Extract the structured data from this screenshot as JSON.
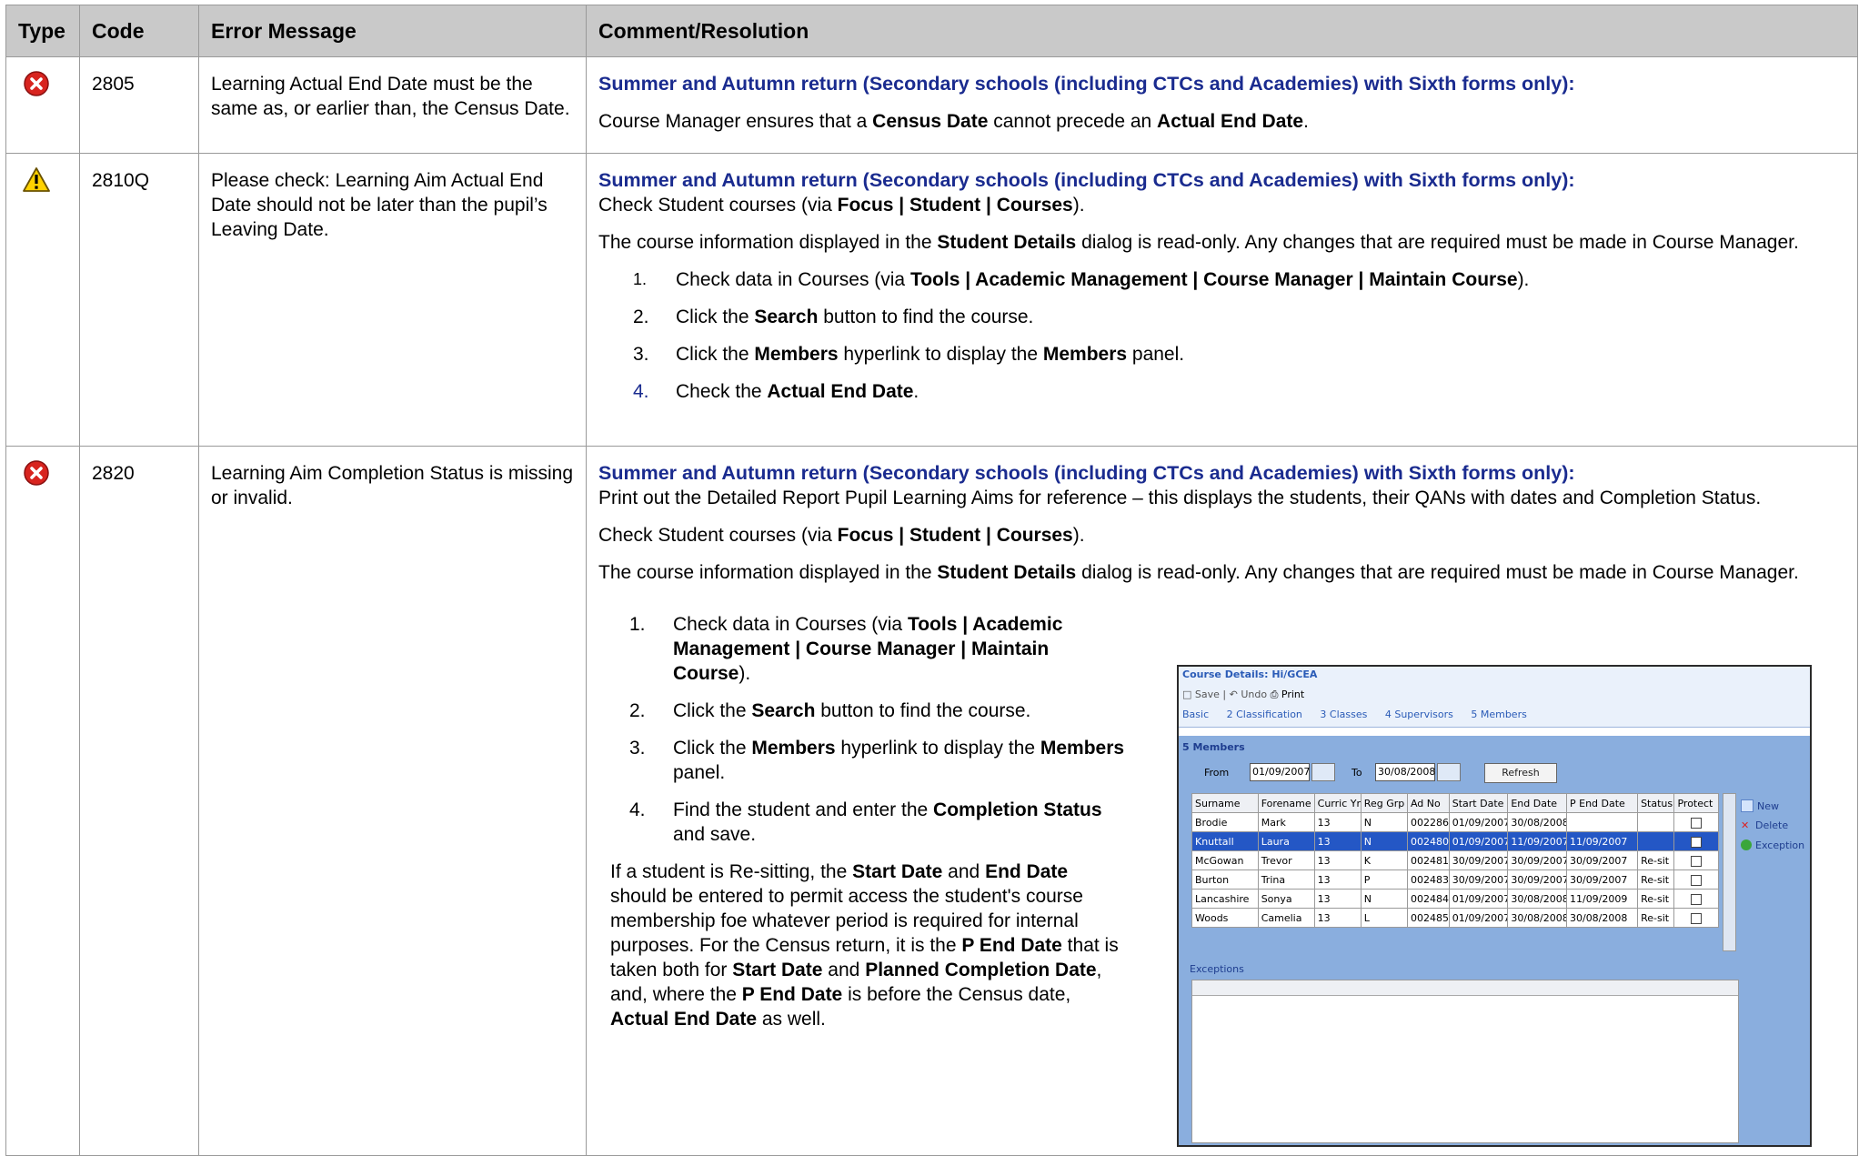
{
  "headers": {
    "type": "Type",
    "code": "Code",
    "error": "Error Message",
    "comment": "Comment/Resolution"
  },
  "rows": [
    {
      "icon": "error-icon",
      "code": "2805",
      "error": "Learning Actual End Date must be the same as, or earlier than, the Census Date.",
      "heading": "Summer and Autumn return (Secondary schools (including CTCs and Academies) with Sixth forms only):",
      "p1_a": "Course Manager ensures that a ",
      "p1_b": "Census Date",
      "p1_c": " cannot precede an ",
      "p1_d": "Actual End Date",
      "p1_e": "."
    },
    {
      "icon": "warning-icon",
      "code": "2810Q",
      "error": "Please check: Learning Aim Actual End Date should not be later than the pupil’s Leaving Date.",
      "heading": "Summer and Autumn return (Secondary schools (including CTCs and Academies) with Sixth forms only):",
      "check_a": "Check Student courses (via ",
      "check_b": "Focus | Student | Courses",
      "check_c": ").",
      "info_a": "The course information displayed in the ",
      "info_b": "Student Details",
      "info_c": " dialog is read-only. Any changes that are required must be made in Course Manager.",
      "steps": [
        {
          "num": "1.",
          "a": "Check data in Courses (via ",
          "b": "Tools | Academic Management | Course Manager | Maintain Course",
          "c": ")."
        },
        {
          "num": "2.",
          "a": "Click the ",
          "b": "Search",
          "c": " button to find the course."
        },
        {
          "num": "3.",
          "a": "Click the ",
          "b": "Members",
          "c": " hyperlink to display the ",
          "d": "Members",
          "e": " panel."
        },
        {
          "num": "4.",
          "a": "Check the ",
          "b": "Actual End Date",
          "c": "."
        }
      ]
    },
    {
      "icon": "error-icon",
      "code": "2820",
      "error": "Learning Aim Completion Status is missing or invalid.",
      "heading": "Summer and Autumn return (Secondary schools (including CTCs and Academies) with Sixth forms only):",
      "print": "Print out the Detailed Report Pupil Learning Aims for reference – this displays the students, their QANs with dates and Completion Status.",
      "check_a": "Check Student courses (via ",
      "check_b": "Focus | Student | Courses",
      "check_c": ").",
      "info_a": "The course information displayed in the ",
      "info_b": "Student Details",
      "info_c": " dialog is read-only. Any changes that are required must be made in Course Manager.",
      "steps": [
        {
          "num": "1.",
          "a": "Check data in Courses (via ",
          "b": "Tools | Academic Management | Course Manager | Maintain Course",
          "c": ")."
        },
        {
          "num": "2.",
          "a": "Click the ",
          "b": "Search",
          "c": " button to find the course."
        },
        {
          "num": "3.",
          "a": "Click the ",
          "b": "Members",
          "c": " hyperlink to display the ",
          "d": "Members",
          "e": " panel."
        },
        {
          "num": "4.",
          "a": "Find the student and enter the ",
          "b": "Completion Status",
          "c": " and save."
        }
      ],
      "resit": [
        {
          "t": "If a student is Re-sitting, the ",
          "b": false
        },
        {
          "t": "Start Date",
          "b": true
        },
        {
          "t": " and ",
          "b": false
        },
        {
          "t": "End Date",
          "b": true
        },
        {
          "t": " should be entered to permit access the student's course membership foe whatever period is required for internal purposes.  For the Census return, it is the ",
          "b": false
        },
        {
          "t": "P End Date",
          "b": true
        },
        {
          "t": " that is taken both for ",
          "b": false
        },
        {
          "t": "Start Date",
          "b": true
        },
        {
          "t": " and ",
          "b": false
        },
        {
          "t": "Planned Completion Date",
          "b": true
        },
        {
          "t": ", and, where the ",
          "b": false
        },
        {
          "t": "P End Date",
          "b": true
        },
        {
          "t": " is before the Census date, ",
          "b": false
        },
        {
          "t": "Actual End Date",
          "b": true
        },
        {
          "t": " as well.",
          "b": false
        }
      ]
    }
  ],
  "screenshot": {
    "title": "Course Details: Hi/GCEA",
    "toolbar": [
      "Save",
      "Undo",
      "Print"
    ],
    "tabs": [
      "Basic",
      "2 Classification",
      "3 Classes",
      "4 Supervisors",
      "5 Members"
    ],
    "panel_title": "5 Members",
    "from_label": "From",
    "from_value": "01/09/2007",
    "to_label": "To",
    "to_value": "30/08/2008",
    "refresh": "Refresh",
    "columns": [
      "Surname",
      "Forename",
      "Curric Yr",
      "Reg Grp",
      "Ad No",
      "Start Date",
      "End Date",
      "P End Date",
      "Status",
      "Protect"
    ],
    "members": [
      [
        "Brodie",
        "Mark",
        "13",
        "N",
        "002286",
        "01/09/2007",
        "30/08/2008",
        "",
        "",
        ""
      ],
      [
        "Knuttall",
        "Laura",
        "13",
        "N",
        "002480",
        "01/09/2007",
        "11/09/2007",
        "11/09/2007",
        "",
        ""
      ],
      [
        "McGowan",
        "Trevor",
        "13",
        "K",
        "002481",
        "30/09/2007",
        "30/09/2007",
        "30/09/2007",
        "Re-sit",
        ""
      ],
      [
        "Burton",
        "Trina",
        "13",
        "P",
        "002483",
        "30/09/2007",
        "30/09/2007",
        "30/09/2007",
        "Re-sit",
        ""
      ],
      [
        "Lancashire",
        "Sonya",
        "13",
        "N",
        "002484",
        "01/09/2007",
        "30/08/2008",
        "11/09/2009",
        "Re-sit",
        ""
      ],
      [
        "Woods",
        "Camelia",
        "13",
        "L",
        "002485",
        "01/09/2007",
        "30/08/2008",
        "30/08/2008",
        "Re-sit",
        ""
      ]
    ],
    "selected_row": 1,
    "side_actions": [
      "New",
      "Delete",
      "Exception"
    ],
    "exceptions_label": "Exceptions"
  }
}
